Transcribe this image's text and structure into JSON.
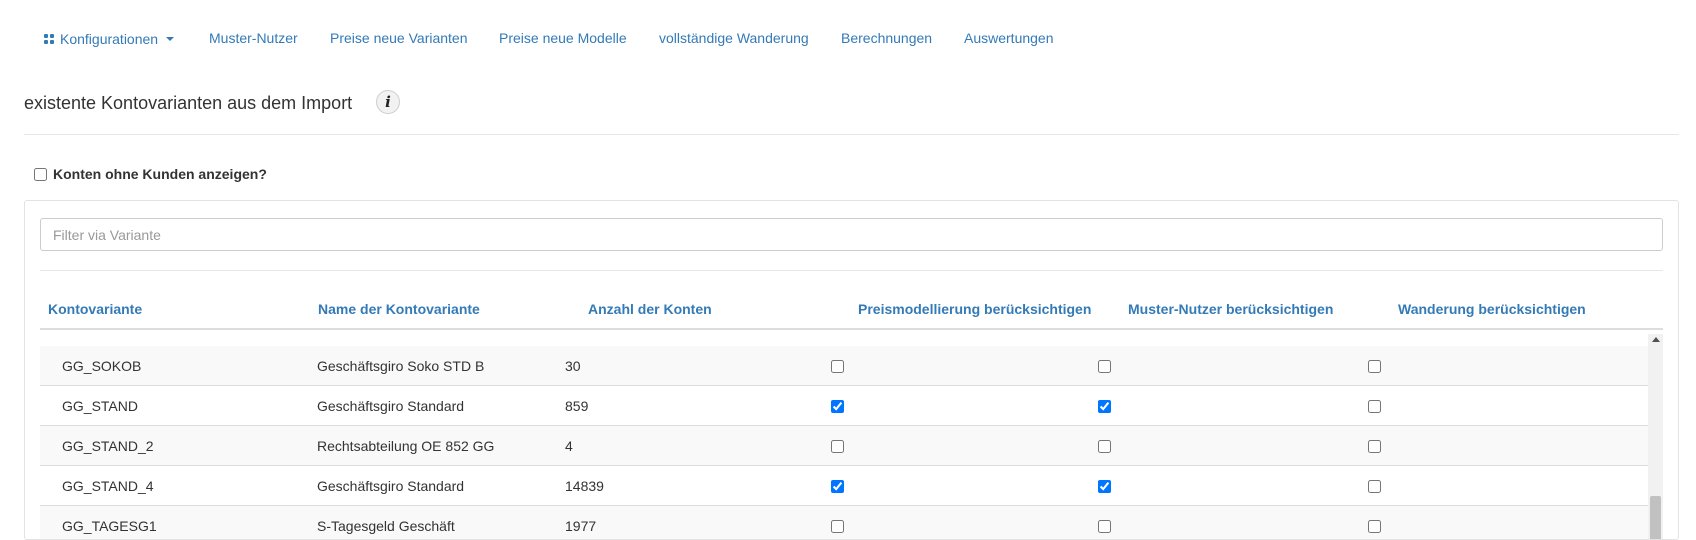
{
  "nav": {
    "items": [
      {
        "label": "Konfigurationen",
        "icon": "grid-icon",
        "dropdown": true
      },
      {
        "label": "Muster-Nutzer"
      },
      {
        "label": "Preise neue Varianten"
      },
      {
        "label": "Preise neue Modelle"
      },
      {
        "label": "vollständige Wanderung"
      },
      {
        "label": "Berechnungen"
      },
      {
        "label": "Auswertungen"
      }
    ]
  },
  "page": {
    "title": "existente Kontovarianten aus dem Import",
    "info_icon": "i"
  },
  "options": {
    "show_accounts_without_customers_label": "Konten ohne Kunden anzeigen?",
    "show_accounts_without_customers_checked": false
  },
  "filter": {
    "placeholder": "Filter via Variante",
    "value": ""
  },
  "table": {
    "columns": [
      "Kontovariante",
      "Name der Kontovariante",
      "Anzahl der Konten",
      "Preismodellierung berücksichtigen",
      "Muster-Nutzer berücksichtigen",
      "Wanderung berücksichtigen"
    ],
    "rows": [
      {
        "variante": "GG_SOKOB",
        "name": "Geschäftsgiro Soko STD B",
        "anzahl": "30",
        "preismodellierung": false,
        "muster_nutzer": false,
        "wanderung": false
      },
      {
        "variante": "GG_STAND",
        "name": "Geschäftsgiro Standard",
        "anzahl": "859",
        "preismodellierung": true,
        "muster_nutzer": true,
        "wanderung": false
      },
      {
        "variante": "GG_STAND_2",
        "name": "Rechtsabteilung OE 852 GG",
        "anzahl": "4",
        "preismodellierung": false,
        "muster_nutzer": false,
        "wanderung": false
      },
      {
        "variante": "GG_STAND_4",
        "name": "Geschäftsgiro Standard",
        "anzahl": "14839",
        "preismodellierung": true,
        "muster_nutzer": true,
        "wanderung": false
      },
      {
        "variante": "GG_TAGESG1",
        "name": "S-Tagesgeld Geschäft",
        "anzahl": "1977",
        "preismodellierung": false,
        "muster_nutzer": false,
        "wanderung": false
      }
    ]
  },
  "colors": {
    "link": "#337ab7",
    "text": "#333333",
    "row_stripe": "#f9f9f9",
    "border": "#dddddd"
  }
}
